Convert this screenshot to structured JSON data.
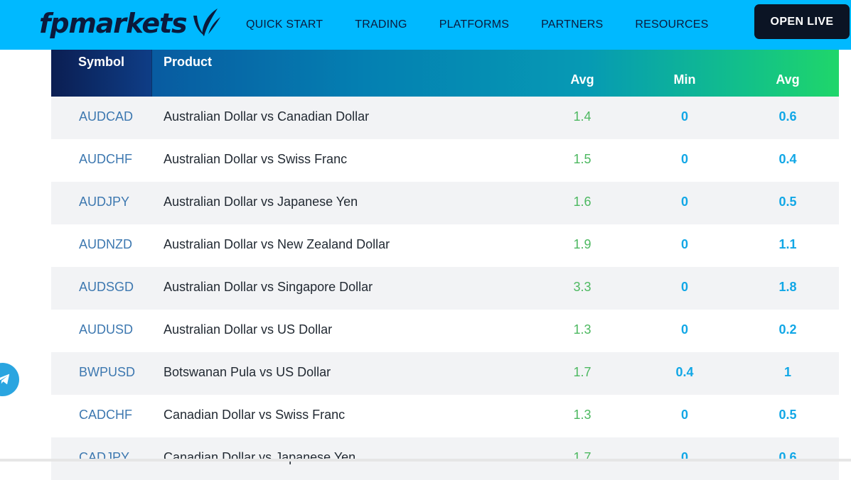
{
  "header": {
    "logo_text": "fpmarkets",
    "nav": [
      "QUICK START",
      "TRADING",
      "PLATFORMS",
      "PARTNERS",
      "RESOURCES"
    ],
    "cta": "OPEN LIVE"
  },
  "table": {
    "headers": {
      "symbol": "Symbol",
      "product": "Product",
      "col1": "Avg",
      "col2": "Min",
      "col3": "Avg"
    },
    "rows": [
      {
        "symbol": "AUDCAD",
        "product": "Australian Dollar vs Canadian Dollar",
        "avg": "1.4",
        "min": "0",
        "avg2": "0.6"
      },
      {
        "symbol": "AUDCHF",
        "product": "Australian Dollar vs Swiss Franc",
        "avg": "1.5",
        "min": "0",
        "avg2": "0.4"
      },
      {
        "symbol": "AUDJPY",
        "product": "Australian Dollar vs Japanese Yen",
        "avg": "1.6",
        "min": "0",
        "avg2": "0.5"
      },
      {
        "symbol": "AUDNZD",
        "product": "Australian Dollar vs New Zealand Dollar",
        "avg": "1.9",
        "min": "0",
        "avg2": "1.1"
      },
      {
        "symbol": "AUDSGD",
        "product": "Australian Dollar vs Singapore Dollar",
        "avg": "3.3",
        "min": "0",
        "avg2": "1.8"
      },
      {
        "symbol": "AUDUSD",
        "product": "Australian Dollar vs US Dollar",
        "avg": "1.3",
        "min": "0",
        "avg2": "0.2"
      },
      {
        "symbol": "BWPUSD",
        "product": "Botswanan Pula vs US Dollar",
        "avg": "1.7",
        "min": "0.4",
        "avg2": "1"
      },
      {
        "symbol": "CADCHF",
        "product": "Canadian Dollar vs Swiss Franc",
        "avg": "1.3",
        "min": "0",
        "avg2": "0.5"
      },
      {
        "symbol": "CADJPY",
        "product": "Canadian Dollar vs Japanese Yen",
        "avg": "1.7",
        "min": "0",
        "avg2": "0.6"
      }
    ]
  },
  "floating": {
    "icon": "telegram-icon"
  },
  "colors": {
    "header_bg": "#00b9ff",
    "cta_bg": "#0b1424",
    "symbol_text": "#3d78b0",
    "avg_text": "#4cb860",
    "min_text": "#11a7e6"
  }
}
